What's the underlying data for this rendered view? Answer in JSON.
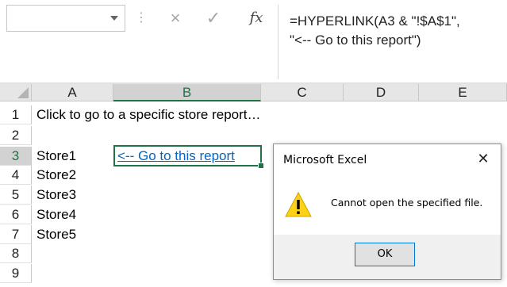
{
  "formula_bar": {
    "name_box_value": "",
    "cancel_icon": "×",
    "enter_icon": "✓",
    "fx_label": "fx",
    "formula": "=HYPERLINK(A3 & \"!$A$1\",\n\"<-- Go to this report\")"
  },
  "columns": [
    "A",
    "B",
    "C",
    "D",
    "E"
  ],
  "rows": [
    "1",
    "2",
    "3",
    "4",
    "5",
    "6",
    "7",
    "8",
    "9"
  ],
  "cells": {
    "A1": "Click to go to a specific store report…",
    "A3": "Store1",
    "B3": "<-- Go to this report",
    "A4": "Store2",
    "A5": "Store3",
    "A6": "Store4",
    "A7": "Store5"
  },
  "selection": {
    "active_cell": "B3",
    "accent": "#217346"
  },
  "dialog": {
    "title": "Microsoft Excel",
    "close_label": "✕",
    "icon": "warning-icon",
    "message": "Cannot open the specified file.",
    "ok_label": "OK"
  },
  "colors": {
    "link": "#0563c1",
    "warning": "#fcd116"
  }
}
